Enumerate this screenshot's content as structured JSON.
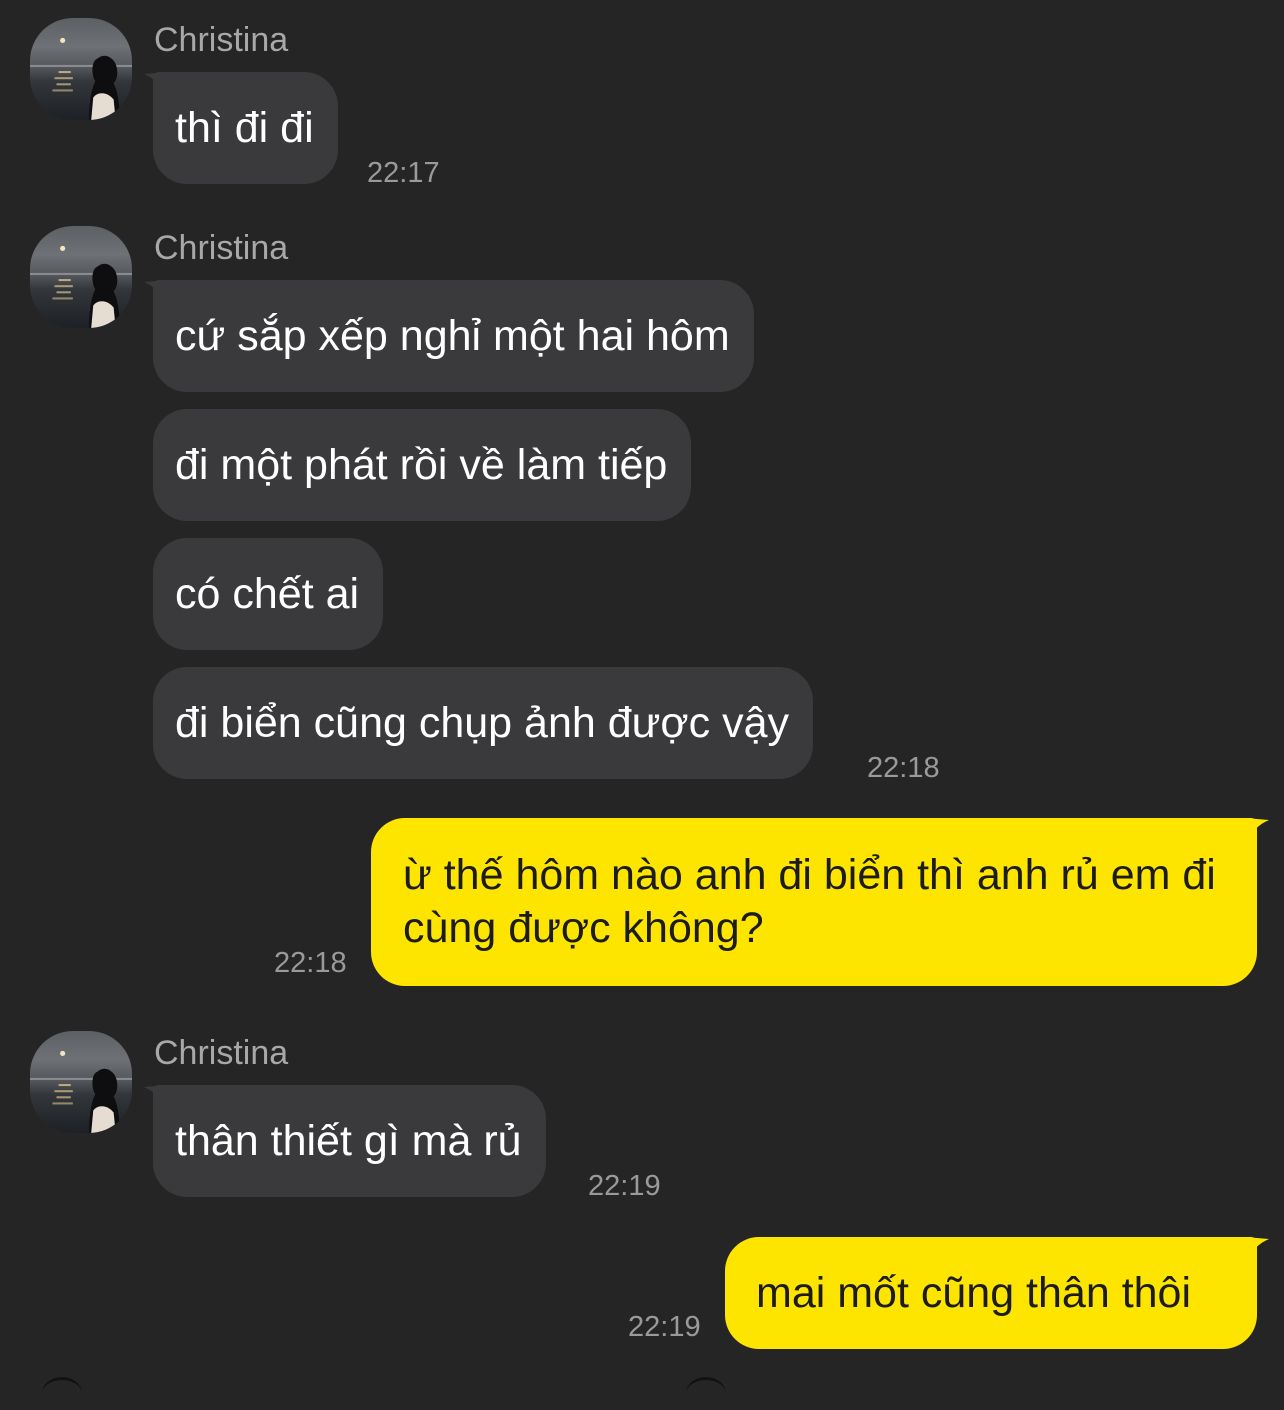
{
  "colors": {
    "background": "#252526",
    "incoming_bubble": "#3a3a3c",
    "outgoing_bubble": "#fee500",
    "sender_name": "#a8a8a8",
    "timestamp": "#9a9a9a"
  },
  "groups": [
    {
      "sender": "Christina",
      "messages": [
        "thì đi đi"
      ],
      "time": "22:17"
    },
    {
      "sender": "Christina",
      "messages": [
        "cứ sắp xếp nghỉ một hai hôm",
        "đi một phát rồi về làm tiếp",
        "có chết ai",
        "đi biển cũng chụp ảnh được vậy"
      ],
      "time": "22:18"
    },
    {
      "outgoing": true,
      "message": "ừ thế hôm nào anh đi biển thì anh rủ em đi cùng được không?",
      "time": "22:18"
    },
    {
      "sender": "Christina",
      "messages": [
        "thân thiết gì mà rủ"
      ],
      "time": "22:19"
    },
    {
      "outgoing": true,
      "message": "mai mốt cũng thân thôi",
      "time": "22:19"
    }
  ]
}
